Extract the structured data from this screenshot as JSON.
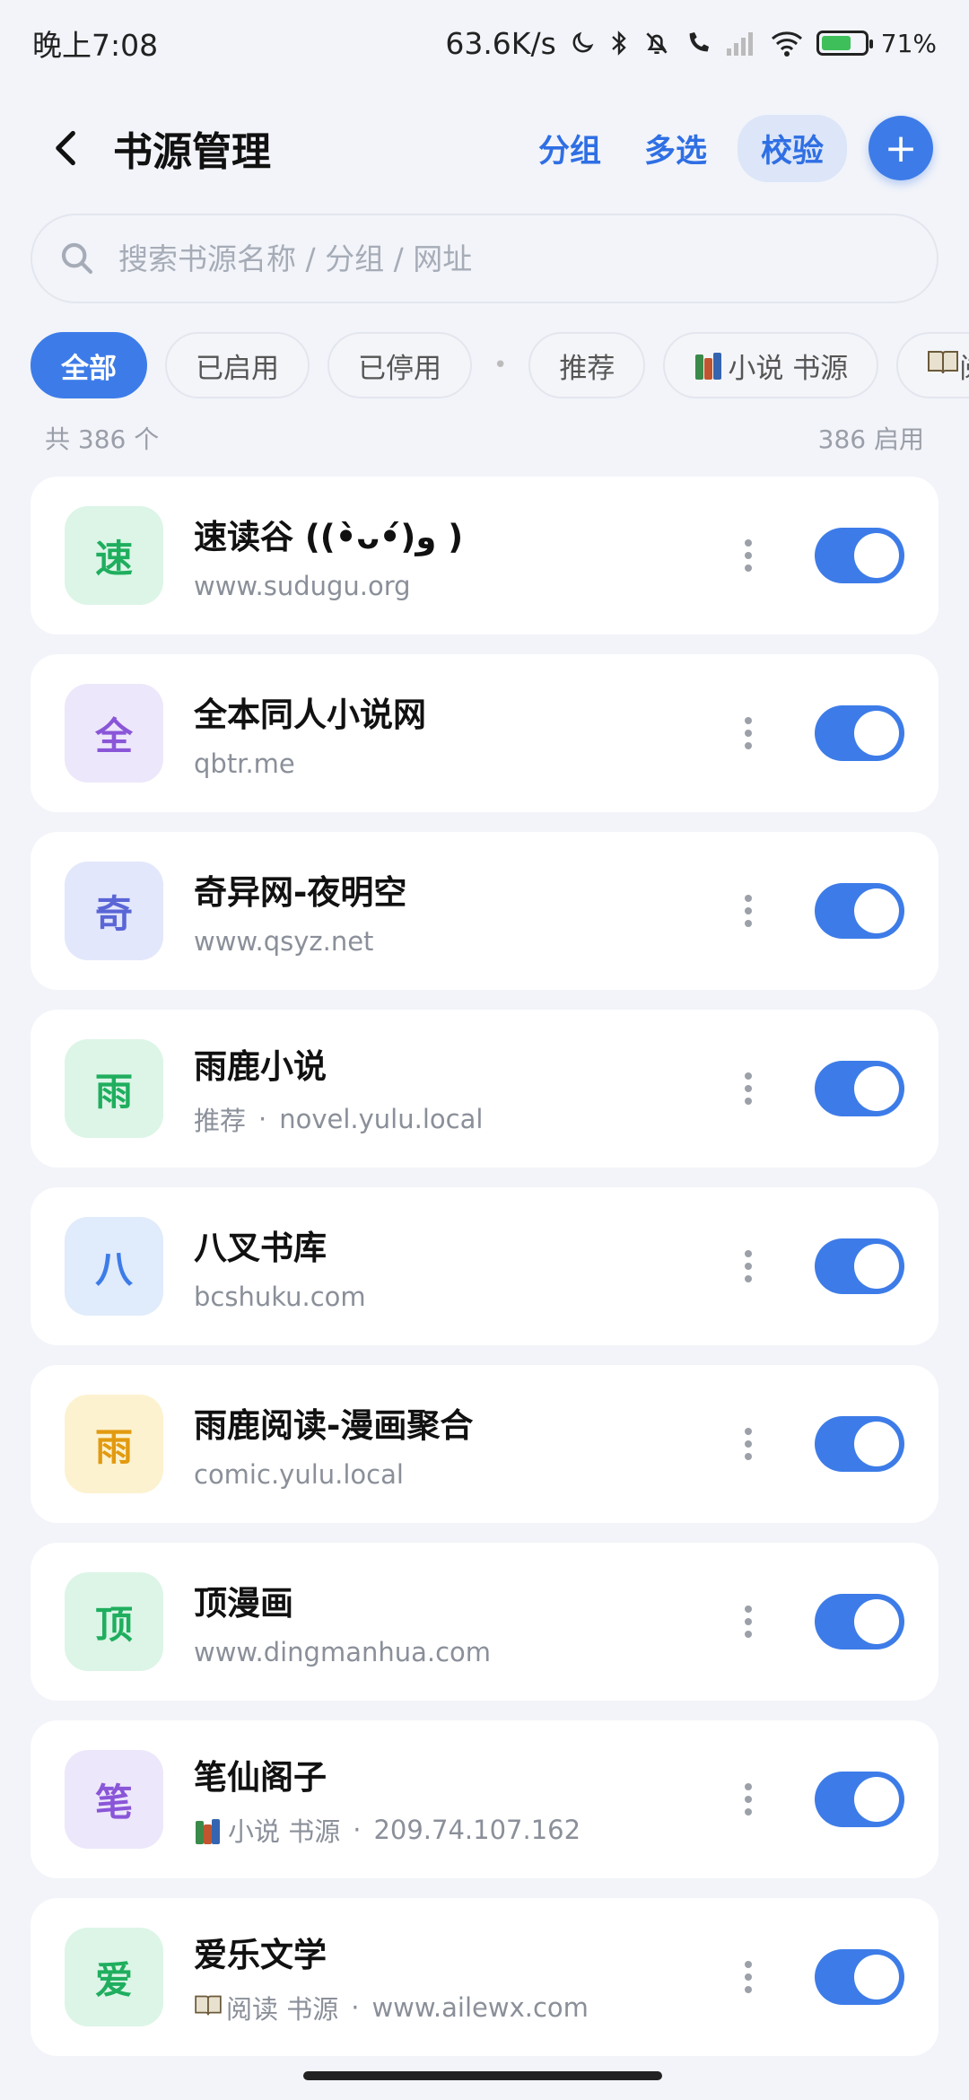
{
  "status_bar": {
    "time": "晚上7:08",
    "net_speed": "63.6K/s",
    "battery": "71%"
  },
  "header": {
    "title": "书源管理",
    "group_label": "分组",
    "multi_label": "多选",
    "check_label": "校验",
    "add_label": "+"
  },
  "search": {
    "placeholder": "搜索书源名称 / 分组 / 网址"
  },
  "filters": {
    "all": "全部",
    "enabled": "已启用",
    "disabled": "已停用",
    "separator": "•",
    "recommend": "推荐",
    "novel": "小说 书源",
    "read": "阅"
  },
  "counts": {
    "total": "共 386 个",
    "enabled": "386 启用"
  },
  "sources": [
    {
      "avatar": "速",
      "name": "速读谷 ((•̀ᴗ•́)و )",
      "group": "",
      "url": "www.sudugu.org",
      "enabled": true,
      "bg": "#dcf5e7",
      "fg": "#1fae5e"
    },
    {
      "avatar": "全",
      "name": "全本同人小说网",
      "group": "",
      "url": "qbtr.me",
      "enabled": true,
      "bg": "#ede7fb",
      "fg": "#8a56d8"
    },
    {
      "avatar": "奇",
      "name": "奇异网-夜明空",
      "group": "",
      "url": "www.qsyz.net",
      "enabled": true,
      "bg": "#e3e7fb",
      "fg": "#5a66d6"
    },
    {
      "avatar": "雨",
      "name": "雨鹿小说",
      "group": "推荐",
      "url": "novel.yulu.local",
      "enabled": true,
      "bg": "#dcf5e7",
      "fg": "#1fae5e"
    },
    {
      "avatar": "八",
      "name": "八叉书库",
      "group": "",
      "url": "bcshuku.com",
      "enabled": true,
      "bg": "#e0ebfb",
      "fg": "#3d7ce8"
    },
    {
      "avatar": "雨",
      "name": "雨鹿阅读-漫画聚合",
      "group": "",
      "url": "comic.yulu.local",
      "enabled": true,
      "bg": "#fcf2cf",
      "fg": "#e29a10"
    },
    {
      "avatar": "顶",
      "name": "顶漫画",
      "group": "",
      "url": "www.dingmanhua.com",
      "enabled": true,
      "bg": "#dcf5e7",
      "fg": "#1fae5e"
    },
    {
      "avatar": "笔",
      "name": "笔仙阁子",
      "group": "小说 书源",
      "group_icon": "books",
      "url": "209.74.107.162",
      "enabled": true,
      "bg": "#ede7fb",
      "fg": "#8a56d8"
    },
    {
      "avatar": "爱",
      "name": "爱乐文学",
      "group": "阅读 书源",
      "group_icon": "open-book",
      "url": "www.ailewx.com",
      "enabled": true,
      "bg": "#dcf5e7",
      "fg": "#1fae5e"
    }
  ],
  "colors": {
    "accent": "#3d7ce8",
    "background": "#f2f4f9"
  }
}
